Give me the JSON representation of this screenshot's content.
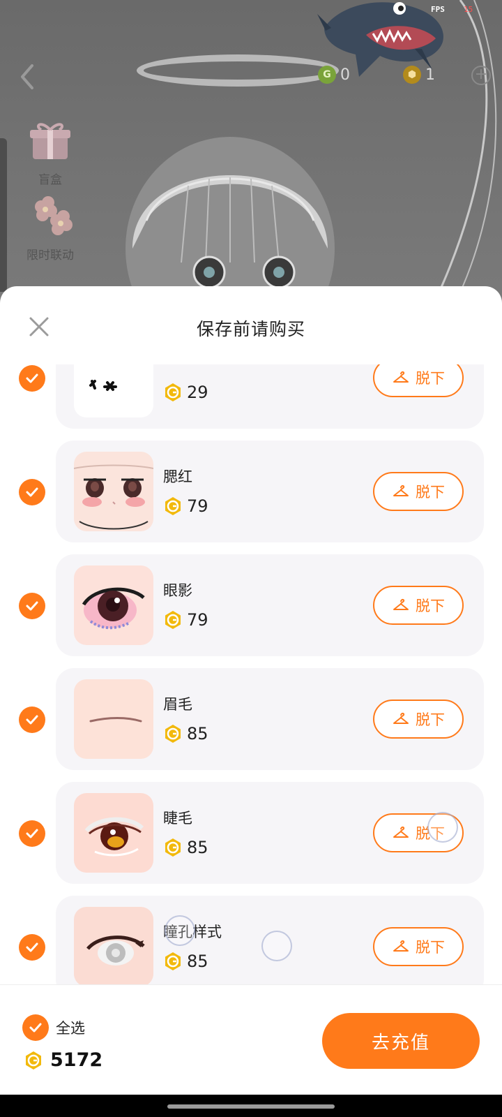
{
  "status": {
    "fps_label": "FPS",
    "fps_value": "15"
  },
  "topbar": {
    "green_coin_count": "0",
    "gold_coin_count": "1"
  },
  "side_menu": [
    {
      "label": "盲盒",
      "icon": "gift-box-icon"
    },
    {
      "label": "限时联动",
      "icon": "flower-icon"
    }
  ],
  "sheet": {
    "title": "保存前请购买",
    "items": [
      {
        "name": "",
        "price": "29",
        "checked": true,
        "remove_label": "脱下",
        "thumb": "face-sticker"
      },
      {
        "name": "腮红",
        "price": "79",
        "checked": true,
        "remove_label": "脱下",
        "thumb": "blush"
      },
      {
        "name": "眼影",
        "price": "79",
        "checked": true,
        "remove_label": "脱下",
        "thumb": "eyeshadow"
      },
      {
        "name": "眉毛",
        "price": "85",
        "checked": true,
        "remove_label": "脱下",
        "thumb": "eyebrow"
      },
      {
        "name": "睫毛",
        "price": "85",
        "checked": true,
        "remove_label": "脱下",
        "thumb": "eyelash"
      },
      {
        "name": "瞳孔样式",
        "price": "85",
        "checked": true,
        "remove_label": "脱下",
        "thumb": "pupil"
      }
    ]
  },
  "footer": {
    "select_all_label": "全选",
    "total": "5172",
    "recharge_label": "去充值"
  },
  "colors": {
    "accent": "#ff7a1a",
    "coin": "#f2b90c"
  }
}
